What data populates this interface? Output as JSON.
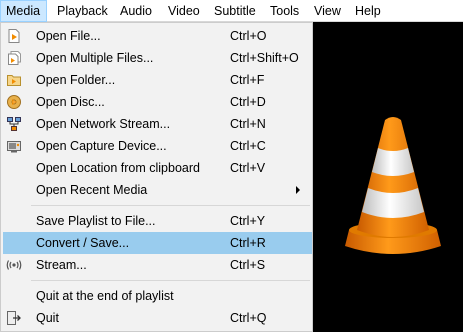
{
  "menubar": {
    "items": [
      "Media",
      "Playback",
      "Audio",
      "Video",
      "Subtitle",
      "Tools",
      "View",
      "Help"
    ]
  },
  "media_menu": {
    "items": [
      {
        "label": "Open File...",
        "shortcut": "Ctrl+O",
        "icon": "file-icon"
      },
      {
        "label": "Open Multiple Files...",
        "shortcut": "Ctrl+Shift+O",
        "icon": "files-icon"
      },
      {
        "label": "Open Folder...",
        "shortcut": "Ctrl+F",
        "icon": "folder-icon"
      },
      {
        "label": "Open Disc...",
        "shortcut": "Ctrl+D",
        "icon": "disc-icon"
      },
      {
        "label": "Open Network Stream...",
        "shortcut": "Ctrl+N",
        "icon": "network-icon"
      },
      {
        "label": "Open Capture Device...",
        "shortcut": "Ctrl+C",
        "icon": "capture-device-icon"
      },
      {
        "label": "Open Location from clipboard",
        "shortcut": "Ctrl+V",
        "icon": ""
      },
      {
        "label": "Open Recent Media",
        "shortcut": "",
        "icon": "",
        "submenu": true
      },
      {
        "label": "Save Playlist to File...",
        "shortcut": "Ctrl+Y",
        "icon": ""
      },
      {
        "label": "Convert / Save...",
        "shortcut": "Ctrl+R",
        "icon": "",
        "highlighted": true
      },
      {
        "label": "Stream...",
        "shortcut": "Ctrl+S",
        "icon": "stream-icon"
      },
      {
        "label": "Quit at the end of playlist",
        "shortcut": "",
        "icon": ""
      },
      {
        "label": "Quit",
        "shortcut": "Ctrl+Q",
        "icon": "quit-icon"
      }
    ]
  },
  "colors": {
    "highlight": "#99ccee",
    "menu_bg": "#f2f2f2",
    "cone_orange": "#f28c00"
  }
}
